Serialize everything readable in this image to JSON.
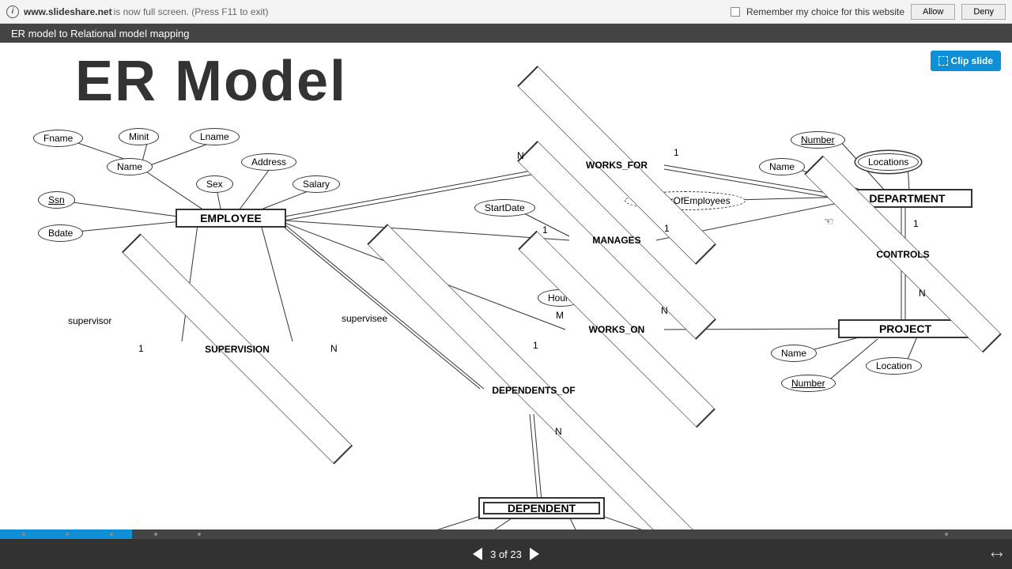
{
  "notice": {
    "url": "www.slideshare.net",
    "message": " is now full screen. (Press F11 to exit)",
    "remember": "Remember my choice for this website",
    "allow": "Allow",
    "deny": "Deny"
  },
  "title": "ER model to Relational model mapping",
  "clip_label": "Clip slide",
  "slide": {
    "heading": "ER Model",
    "entities": {
      "employee": "EMPLOYEE",
      "department": "DEPARTMENT",
      "project": "PROJECT",
      "dependent": "DEPENDENT"
    },
    "relationships": {
      "works_for": "WORKS_FOR",
      "manages": "MANAGES",
      "works_on": "WORKS_ON",
      "controls": "CONTROLS",
      "supervision": "SUPERVISION",
      "dependents_of": "DEPENDENTS_OF"
    },
    "attributes": {
      "fname": "Fname",
      "minit": "Minit",
      "lname": "Lname",
      "name": "Name",
      "ssn": "Ssn",
      "sex": "Sex",
      "address": "Address",
      "salary": "Salary",
      "bdate": "Bdate",
      "startdate": "StartDate",
      "num_employees": "NumberOfEmployees",
      "dept_name": "Name",
      "dept_number": "Number",
      "locations": "Locations",
      "hours": "Hours",
      "proj_name": "Name",
      "proj_location": "Location",
      "proj_number": "Number"
    },
    "roles": {
      "supervisor": "supervisor",
      "supervisee": "supervisee"
    },
    "cardinality": {
      "one": "1",
      "n": "N",
      "m": "M"
    }
  },
  "nav": {
    "page_indicator": "3 of 23"
  }
}
